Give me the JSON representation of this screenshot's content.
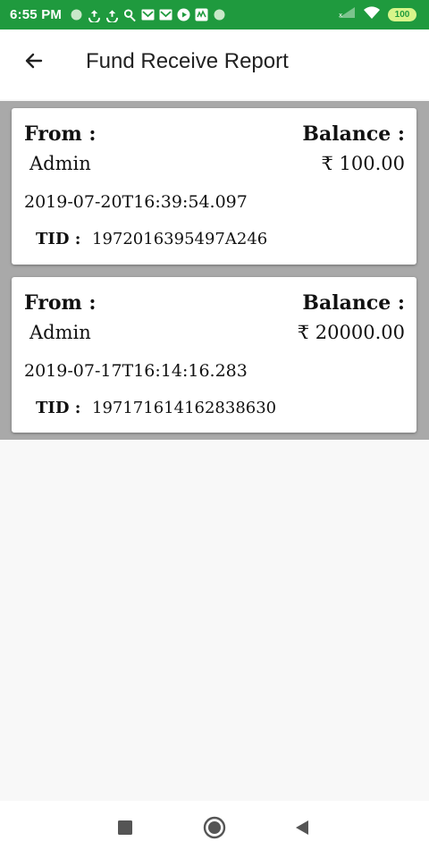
{
  "status_bar": {
    "time": "6:55 PM",
    "battery": "100",
    "icons": [
      "notification-dot-icon",
      "sync-icon",
      "sync-icon",
      "app-icon",
      "mail-icon",
      "mail-icon",
      "play-icon",
      "app-icon",
      "notification-dot-icon"
    ],
    "signal_icon": "signal-icon",
    "wifi_icon": "wifi-icon"
  },
  "app_bar": {
    "title": "Fund Receive Report",
    "back_icon": "arrow-left-icon"
  },
  "cards": [
    {
      "from_label": "From :",
      "balance_label": "Balance :",
      "from_value": "Admin",
      "balance_value": "₹ 100.00",
      "date": "2019-07-20T16:39:54.097",
      "tid_label": "TID :",
      "tid_value": "1972016395497A246"
    },
    {
      "from_label": "From :",
      "balance_label": "Balance :",
      "from_value": "Admin",
      "balance_value": "₹ 20000.00",
      "date": "2019-07-17T16:14:16.283",
      "tid_label": "TID :",
      "tid_value": "197171614162838630"
    }
  ],
  "nav_bar": {
    "recents_icon": "square-icon",
    "home_icon": "circle-icon",
    "back_icon": "triangle-back-icon"
  },
  "colors": {
    "status_bar": "#1f9a3e",
    "list_background": "#a9a9a9",
    "page_background": "#f8f8f8"
  }
}
